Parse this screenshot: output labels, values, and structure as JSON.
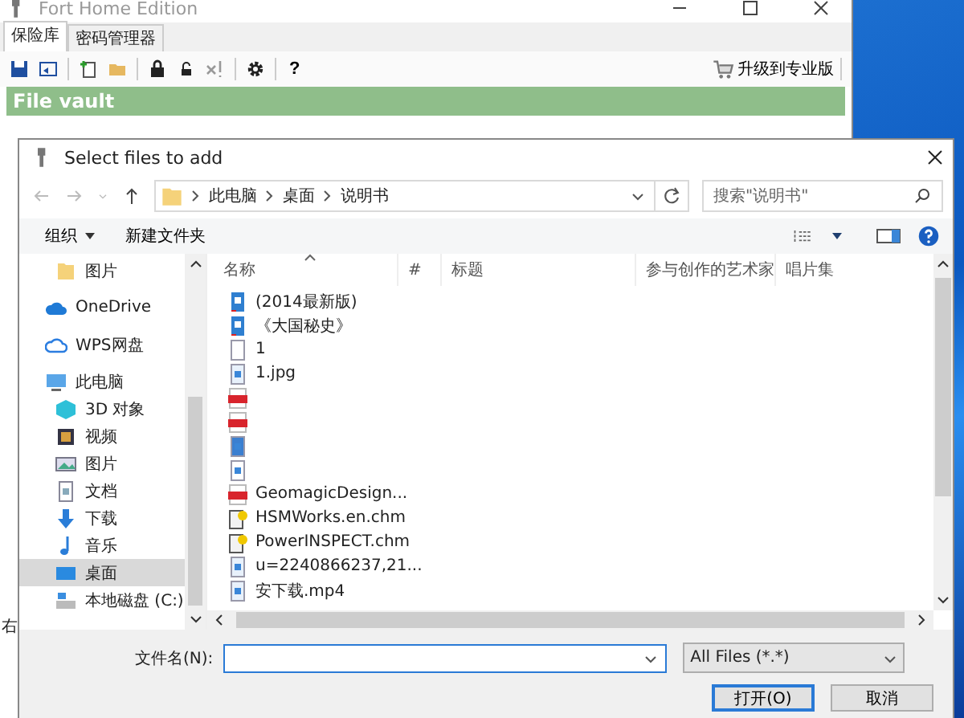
{
  "app": {
    "title": "Fort Home Edition",
    "tabs": [
      {
        "label": "保险库",
        "selected": true
      },
      {
        "label": "密码管理器",
        "selected": false
      }
    ],
    "help_label": "?",
    "upgrade_label": "升级到专业版",
    "vault_title": "File vault",
    "status_text": "右"
  },
  "dialog": {
    "title": "Select files to add",
    "breadcrumb": [
      "此电脑",
      "桌面",
      "说明书"
    ],
    "search": {
      "placeholder": "搜索\"说明书\""
    },
    "toolbar": {
      "organize": "组织",
      "new_folder": "新建文件夹"
    },
    "nav": [
      {
        "label": "图片",
        "kind": "folder",
        "selected": false
      },
      {
        "label": "OneDrive",
        "kind": "cloud",
        "selected": false
      },
      {
        "label": "WPS网盘",
        "kind": "cloud-outline",
        "selected": false
      },
      {
        "label": "此电脑",
        "kind": "pc",
        "selected": false,
        "children": [
          {
            "label": "3D 对象",
            "kind": "cube",
            "selected": false
          },
          {
            "label": "视频",
            "kind": "video",
            "selected": false
          },
          {
            "label": "图片",
            "kind": "pictures",
            "selected": false
          },
          {
            "label": "文档",
            "kind": "document",
            "selected": false
          },
          {
            "label": "下载",
            "kind": "download",
            "selected": false
          },
          {
            "label": "音乐",
            "kind": "music",
            "selected": false
          },
          {
            "label": "桌面",
            "kind": "desktop",
            "selected": true
          },
          {
            "label": "本地磁盘 (C:)",
            "kind": "drive",
            "selected": false
          }
        ]
      }
    ],
    "columns": [
      "名称",
      "#",
      "标题",
      "参与创作的艺术家",
      "唱片集"
    ],
    "files": [
      {
        "name": "(2014最新版)",
        "kind": "ebook"
      },
      {
        "name": "《大国秘史》",
        "kind": "ebook"
      },
      {
        "name": "1",
        "kind": "blank"
      },
      {
        "name": "1.jpg",
        "kind": "image"
      },
      {
        "kind": "pdf"
      },
      {
        "kind": "pdf"
      },
      {
        "kind": "picture"
      },
      {
        "kind": "word"
      },
      {
        "name": "GeomagicDesign...",
        "kind": "pdf"
      },
      {
        "name": "HSMWorks.en.chm",
        "kind": "chm"
      },
      {
        "name": "PowerINSPECT.chm",
        "kind": "chm"
      },
      {
        "name": "u=2240866237,21...",
        "kind": "image"
      },
      {
        "name": "安下载.mp4",
        "kind": "video"
      }
    ],
    "filename_label": "文件名(N):",
    "filter": "All Files (*.*)",
    "buttons": [
      {
        "label": "打开(O)",
        "kind": "primary"
      },
      {
        "label": "取消",
        "kind": "normal"
      }
    ]
  }
}
